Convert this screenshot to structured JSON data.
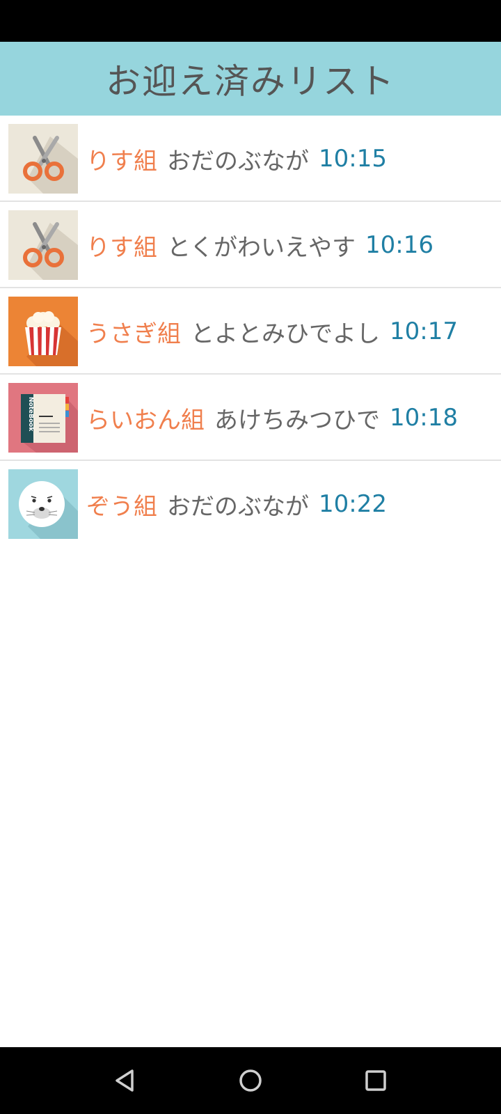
{
  "header": {
    "title": "お迎え済みリスト"
  },
  "rows": [
    {
      "class_name": "りす組",
      "child_name": "おだのぶなが",
      "time": "10:15",
      "icon": "scissors-icon",
      "thumb_bg": "#ece7da"
    },
    {
      "class_name": "りす組",
      "child_name": "とくがわいえやす",
      "time": "10:16",
      "icon": "scissors-icon",
      "thumb_bg": "#ece7da"
    },
    {
      "class_name": "うさぎ組",
      "child_name": "とよとみひでよし",
      "time": "10:17",
      "icon": "popcorn-icon",
      "thumb_bg": "#ec8435"
    },
    {
      "class_name": "らいおん組",
      "child_name": "あけちみつひで",
      "time": "10:18",
      "icon": "notebook-icon",
      "thumb_bg": "#e07680",
      "icon_text": "NoteBook"
    },
    {
      "class_name": "ぞう組",
      "child_name": "おだのぶなが",
      "time": "10:22",
      "icon": "seal-icon",
      "thumb_bg": "#9fd7df"
    }
  ],
  "colors": {
    "header_bg": "#96d5dd",
    "class_text": "#f07f4d",
    "time_text": "#1f7fa4"
  },
  "nav": {
    "back": "back-icon",
    "home": "home-icon",
    "recents": "recents-icon"
  }
}
